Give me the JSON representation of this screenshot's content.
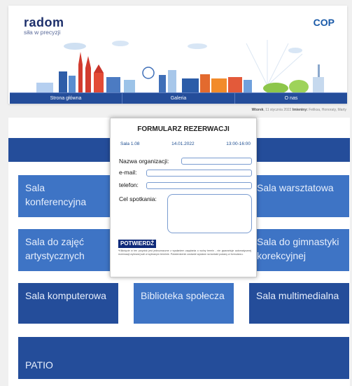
{
  "header": {
    "logo_left": {
      "word": "radom",
      "tagline": "siła w precyzji"
    },
    "logo_right": {
      "word": "COP"
    }
  },
  "nav": {
    "items": [
      {
        "label": "Strona główna"
      },
      {
        "label": "Galeria"
      },
      {
        "label": "O nas"
      }
    ]
  },
  "dateline": {
    "day": "Wtorek",
    "date": "11 stycznia 2022",
    "names_label": "Imieniny:",
    "names": "Feliksa, Honoraty, Marty"
  },
  "tiles": [
    {
      "label": "Sala konferencyjna"
    },
    {
      "label": "Sala warsztatowa"
    },
    {
      "label": "Sala do zajęć artystycznych"
    },
    {
      "label": "Sala do gimnastyki korekcyjnej"
    },
    {
      "label": "Sala komputerowa"
    },
    {
      "label": "Biblioteka społecza"
    },
    {
      "label": "Sala multimedialna"
    },
    {
      "label": "PATIO"
    }
  ],
  "modal": {
    "title": "FORMULARZ REZERWACJI",
    "room": "Sala 1.08",
    "date": "14.01.2022",
    "time": "13:00-16:00",
    "fields": {
      "org_label": "Nazwa organizacji:",
      "email_label": "e-mail:",
      "phone_label": "telefon:",
      "purpose_label": "Cel spotkania:"
    },
    "confirm_label": "POTWIERDŹ",
    "note": "*Kliknięcie w ten przycisk jest jednoznaczne z wysłaniem zapytania o wolny termin - nie gwarantuje automatycznej rezerwacji wybranej sali w wybranym terminie. Potwierdzenie zostanie wysłane na kontakt podany w formularzu."
  }
}
